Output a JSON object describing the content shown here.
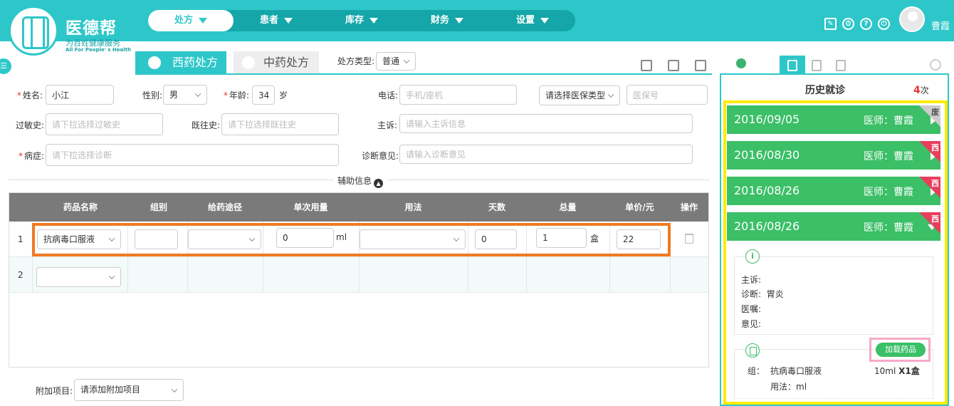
{
  "brand": {
    "name": "医德帮",
    "slogan": "为百姓健康服务",
    "slogan_en": "All For People' s Health"
  },
  "nav": [
    {
      "label": "处方",
      "active": true
    },
    {
      "label": "患者"
    },
    {
      "label": "库存"
    },
    {
      "label": "财务"
    },
    {
      "label": "设置"
    }
  ],
  "user": {
    "name": "曹霞"
  },
  "tabs": {
    "western": "西药处方",
    "chinese": "中药处方"
  },
  "prescription_type": {
    "label": "处方类型:",
    "value": "普通"
  },
  "form": {
    "name_label": "姓名:",
    "name_value": "小江",
    "gender_label": "性别:",
    "gender_value": "男",
    "age_label": "年龄:",
    "age_value": "34",
    "age_unit": "岁",
    "phone_label": "电话:",
    "phone_placeholder": "手机/座机",
    "insurance_select": "请选择医保类型",
    "insurance_placeholder": "医保号",
    "allergy_label": "过敏史:",
    "allergy_placeholder": "请下拉选择过敏史",
    "history_label": "既往史:",
    "history_placeholder": "请下拉选择既往史",
    "complaint_label": "主诉:",
    "complaint_placeholder": "请输入主诉信息",
    "disease_label": "病症:",
    "disease_placeholder": "请下拉选择诊断",
    "opinion_label": "诊断意见:",
    "opinion_placeholder": "请输入诊断意见"
  },
  "aux_label": "辅助信息",
  "table": {
    "headers": [
      "药品名称",
      "组别",
      "给药途径",
      "单次用量",
      "用法",
      "天数",
      "总量",
      "单价/元",
      "操作"
    ],
    "rows": [
      {
        "num": "1",
        "drug": "抗病毒口服液",
        "group": "",
        "route": "",
        "dose": "0",
        "dose_unit": "ml",
        "usage": "",
        "days": "0",
        "total": "1",
        "total_unit": "盒",
        "price": "22"
      },
      {
        "num": "2",
        "drug": ""
      }
    ]
  },
  "addon": {
    "label": "附加项目:",
    "placeholder": "请添加附加项目"
  },
  "history": {
    "title": "历史就诊",
    "count": "4",
    "count_unit": "次",
    "records": [
      {
        "date": "2016/09/05",
        "doctor": "医师：曹霞",
        "tag": "废"
      },
      {
        "date": "2016/08/30",
        "doctor": "医师：曹霞",
        "tag": "西"
      },
      {
        "date": "2016/08/26",
        "doctor": "医师：曹霞",
        "tag": "西"
      },
      {
        "date": "2016/08/26",
        "doctor": "医师：曹霞",
        "tag": "西"
      }
    ],
    "detail": {
      "complaint": "主诉:",
      "diagnosis_label": "诊断:",
      "diagnosis_value": "胃炎",
      "advice": "医嘱:",
      "opinion": "意见:"
    },
    "load_button": "加载药品",
    "med": {
      "group_label": "组：",
      "name": "抗病毒口服液",
      "dose": "10ml",
      "qty": "X1盒",
      "usage": "用法：ml"
    }
  },
  "colors": {
    "primary": "#2ec7c9",
    "green": "#3bbf67",
    "highlight_orange": "#f07a22",
    "highlight_yellow": "#ffeb00",
    "highlight_pink": "#f5a9c8"
  }
}
